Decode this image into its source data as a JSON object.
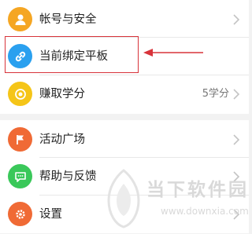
{
  "menu_group_1": {
    "items": [
      {
        "label": "帐号与安全",
        "icon": "person-icon",
        "color": "#f5a623"
      },
      {
        "label": "当前绑定平板",
        "icon": "link-icon",
        "color": "#2aa0ef"
      },
      {
        "label": "赚取学分",
        "icon": "coin-icon",
        "color": "#f5c518",
        "value": "5学分"
      }
    ]
  },
  "menu_group_2": {
    "items": [
      {
        "label": "活动广场",
        "icon": "flag-icon",
        "color": "#f06a35"
      },
      {
        "label": "帮助与反馈",
        "icon": "message-icon",
        "color": "#3ac85a"
      },
      {
        "label": "设置",
        "icon": "gear-icon",
        "color": "#f06a35"
      }
    ]
  },
  "annotation": {
    "highlight_color": "#d8333a"
  },
  "watermark": {
    "text": "当下软件园",
    "url": "www.downxia.com"
  }
}
